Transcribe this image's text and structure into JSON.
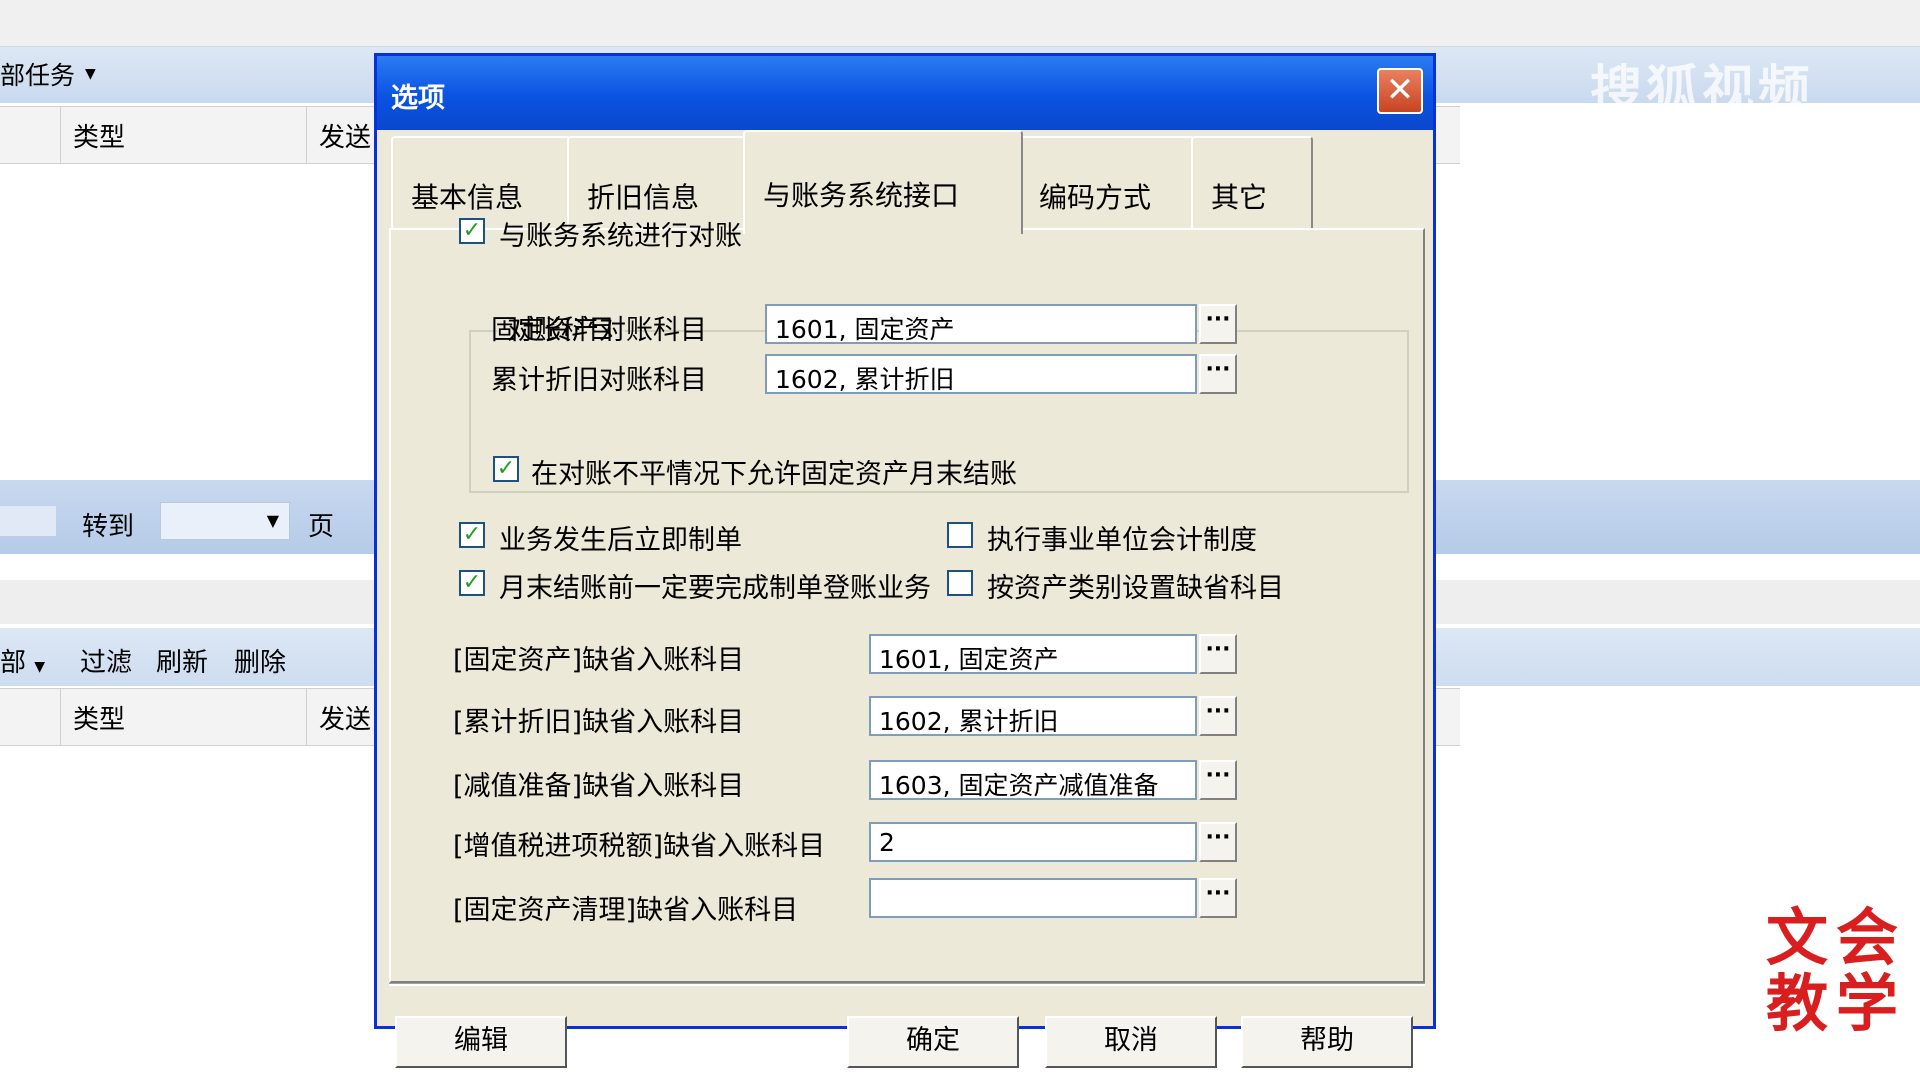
{
  "background": {
    "task_dropdown": "部任务",
    "columns_top": [
      "类型",
      "发送"
    ],
    "pager": {
      "goto_label": "转到",
      "page_label": "页"
    },
    "toolbar2": {
      "all_label": "部",
      "filter": "过滤",
      "refresh": "刷新",
      "delete": "删除"
    },
    "columns_bottom": [
      "类型",
      "发送"
    ],
    "watermark": "搜狐视频",
    "logo_chars": [
      "文",
      "会",
      "教",
      "学"
    ]
  },
  "dialog": {
    "title": "选项",
    "close_symbol": "✕",
    "tabs": [
      "基本信息",
      "折旧信息",
      "与账务系统接口",
      "编码方式",
      "其它"
    ],
    "active_tab": 2,
    "reconcile": {
      "checked": true,
      "label": "与账务系统进行对账"
    },
    "group_title": "对账科目",
    "fixed_asset_subject": {
      "label": "固定资产对账科目",
      "value": "1601, 固定资产"
    },
    "depreciation_subject": {
      "label": "累计折旧对账科目",
      "value": "1602, 累计折旧"
    },
    "allow_close": {
      "checked": true,
      "label": "在对账不平情况下允许固定资产月末结账"
    },
    "immediate_voucher": {
      "checked": true,
      "label": "业务发生后立即制单"
    },
    "public_institution": {
      "checked": false,
      "label": "执行事业单位会计制度"
    },
    "month_end": {
      "checked": true,
      "label": "月末结账前一定要完成制单登账业务"
    },
    "by_category": {
      "checked": false,
      "label": "按资产类别设置缺省科目"
    },
    "defaults": [
      {
        "label": "[固定资产]缺省入账科目",
        "value": "1601, 固定资产"
      },
      {
        "label": "[累计折旧]缺省入账科目",
        "value": "1602, 累计折旧"
      },
      {
        "label": "[减值准备]缺省入账科目",
        "value": "1603, 固定资产减值准备"
      },
      {
        "label": "[增值税进项税额]缺省入账科目",
        "value": "2"
      },
      {
        "label": "[固定资产清理]缺省入账科目",
        "value": ""
      }
    ],
    "browse_symbol": "···",
    "buttons": {
      "edit": "编辑",
      "ok": "确定",
      "cancel": "取消",
      "help": "帮助"
    }
  }
}
